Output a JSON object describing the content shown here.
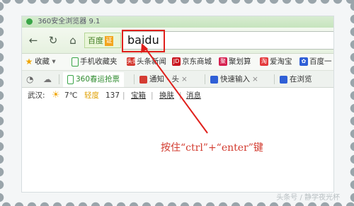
{
  "window": {
    "title": "360安全浏览器 9.1"
  },
  "navbar": {
    "back_icon": "back-arrow-icon",
    "refresh_icon": "refresh-icon",
    "home_icon": "home-icon",
    "cert_label": "百度",
    "cert_seal": "证",
    "url_value": "baidu"
  },
  "bookmarks": [
    {
      "label": "收藏",
      "icon": "star-icon"
    },
    {
      "label": "手机收藏夹",
      "icon": "phone-icon"
    },
    {
      "label": "头条新闻",
      "icon_text": "头条"
    },
    {
      "label": "京东商城",
      "icon_text": "JD"
    },
    {
      "label": "聚划算",
      "icon_text": "聚"
    },
    {
      "label": "爱淘宝",
      "icon_text": "淘"
    },
    {
      "label": "百度一",
      "icon": "paw-icon"
    }
  ],
  "tabs": [
    {
      "label": "360春运抢票"
    },
    {
      "label": "通知 - 头"
    },
    {
      "label": "快速输入"
    },
    {
      "label": "在浏览"
    }
  ],
  "infobar": {
    "city": "武汉:",
    "temp": "7℃",
    "aqi_label": "轻度",
    "aqi_value": "137",
    "treasure": "宝箱",
    "skin": "换肤",
    "news": "消息"
  },
  "annotation": "按住“ctrl”+“enter”键",
  "watermark": "头条号 / 静学夜光杯",
  "colors": {
    "accent_red": "#e0201c",
    "annotation_red": "#d23a2e",
    "brand_green": "#3aa648"
  }
}
